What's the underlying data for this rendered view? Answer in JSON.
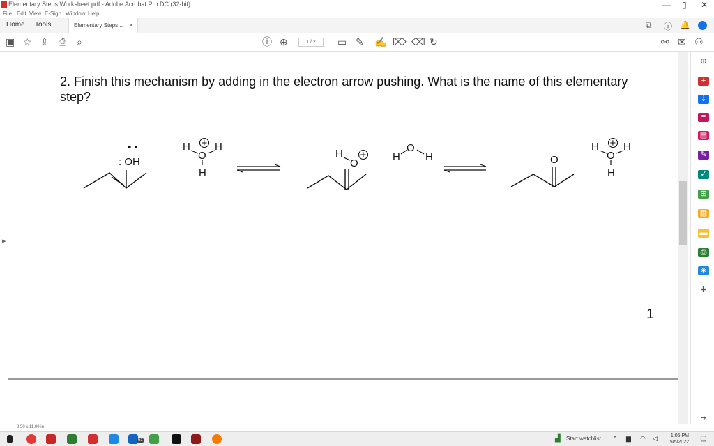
{
  "window": {
    "title": "Elementary Steps Worksheet.pdf - Adobe Acrobat Pro DC (32-bit)",
    "minimize": "—",
    "maximize": "▯",
    "close": "✕"
  },
  "menu": [
    "File",
    "Edit",
    "View",
    "E-Sign",
    "Window",
    "Help"
  ],
  "tabs": {
    "home": "Home",
    "tools": "Tools",
    "document": "Elementary Steps ...",
    "close": "×"
  },
  "toolbar": {
    "page_current": "1",
    "page_total": "/ 2"
  },
  "document": {
    "question": "2. Finish this mechanism by adding in the electron arrow pushing. What is the name of this elementary step?",
    "page_number": "1",
    "chem": {
      "oh_lone_pair": "• •",
      "oh_label": ": OH",
      "h_left": "H",
      "h_right": "H",
      "o": "O",
      "h_bottom": "H",
      "plus": "+",
      "ketone_o": "O"
    }
  },
  "status": {
    "page_size": "8.50 x 11.00 in"
  },
  "taskbar": {
    "watchlist": "Start watchlist",
    "badge": "61",
    "time": "1:05 PM",
    "date": "5/5/2022"
  },
  "colors": {
    "acrobat_red": "#d32f2f",
    "accent_blue": "#1473e6"
  }
}
